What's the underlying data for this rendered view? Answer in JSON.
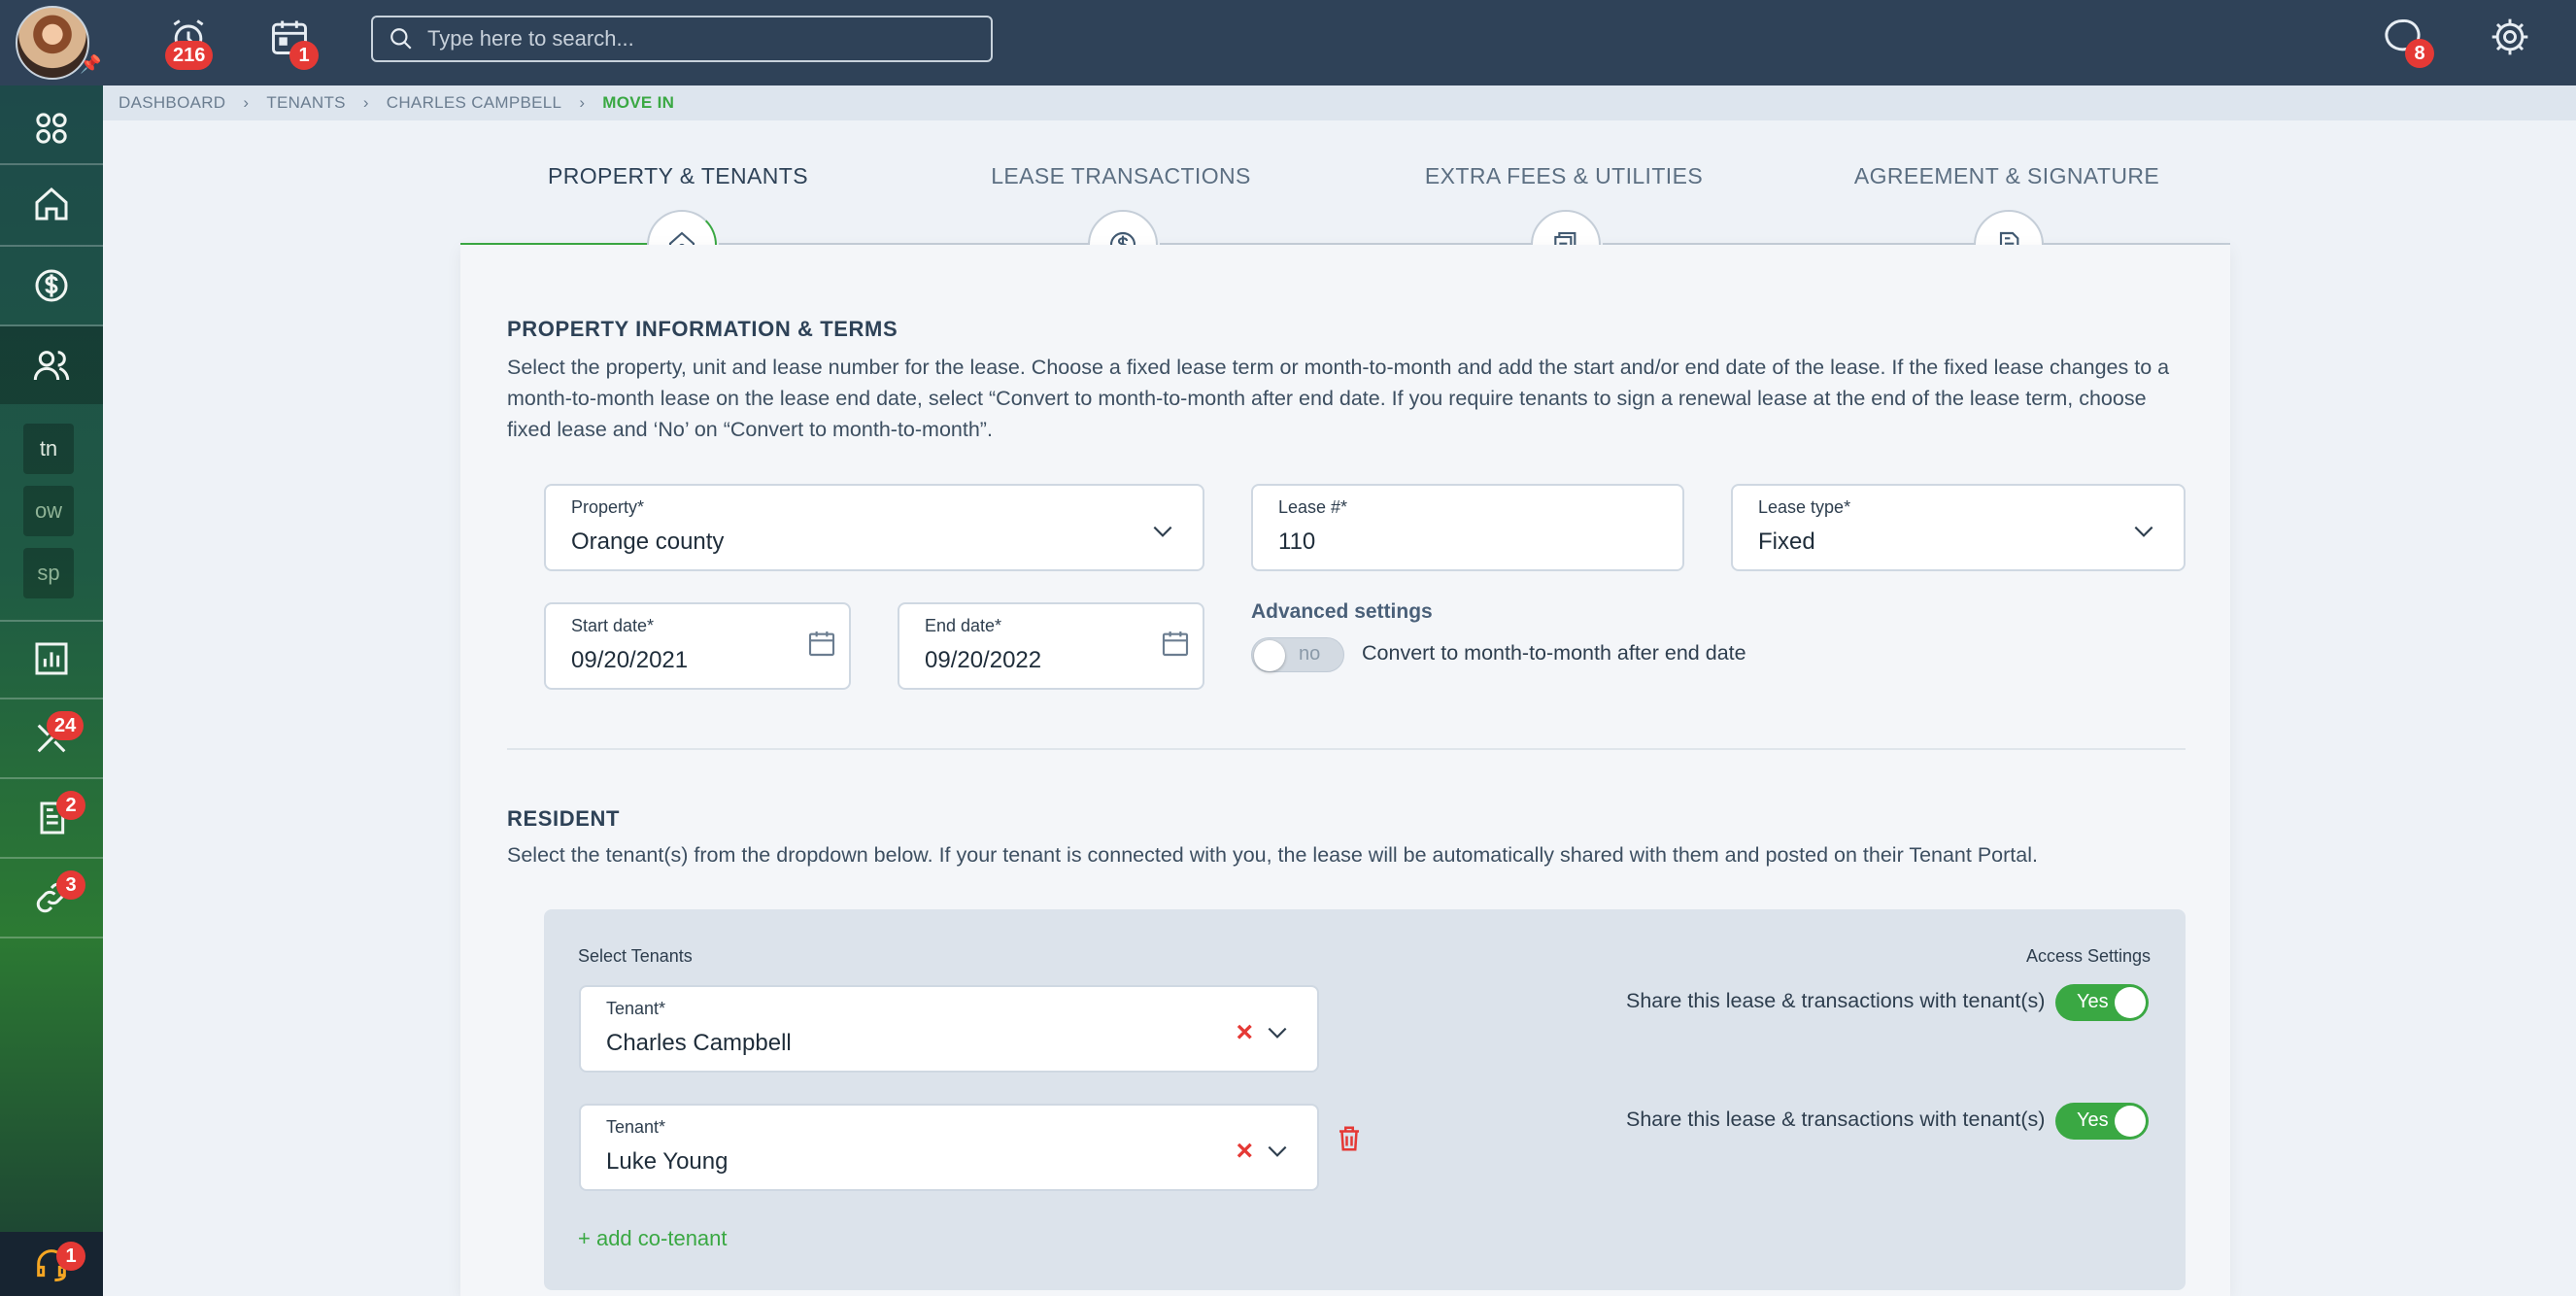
{
  "topbar": {
    "search_placeholder": "Type here to search...",
    "alarm_badge": "216",
    "calendar_badge": "1",
    "chat_badge": "8"
  },
  "sidebar": {
    "chips": [
      "tn",
      "ow",
      "sp"
    ],
    "maintenance_badge": "24",
    "documents_badge": "2",
    "links_badge": "3",
    "support_badge": "1"
  },
  "breadcrumb": [
    "DASHBOARD",
    "TENANTS",
    "CHARLES CAMPBELL",
    "MOVE IN"
  ],
  "steps": [
    {
      "label": "PROPERTY & TENANTS",
      "icon": "home-icon"
    },
    {
      "label": "LEASE TRANSACTIONS",
      "icon": "dollar-icon"
    },
    {
      "label": "EXTRA FEES & UTILITIES",
      "icon": "documents-icon"
    },
    {
      "label": "AGREEMENT & SIGNATURE",
      "icon": "document-icon"
    }
  ],
  "property_section": {
    "title": "PROPERTY INFORMATION & TERMS",
    "description": "Select the property, unit and lease number for the lease. Choose a fixed lease term or month-to-month and add the start and/or end date of the lease. If the fixed lease changes to a month-to-month lease on the lease end date, select “Convert to month-to-month after end date. If you require tenants to sign a renewal lease at the end of the lease term, choose fixed lease and ‘No’ on “Convert to month-to-month”.",
    "property": {
      "label": "Property*",
      "value": "Orange county"
    },
    "lease_number": {
      "label": "Lease #*",
      "value": "110"
    },
    "lease_type": {
      "label": "Lease type*",
      "value": "Fixed"
    },
    "start_date": {
      "label": "Start date*",
      "value": "09/20/2021"
    },
    "end_date": {
      "label": "End date*",
      "value": "09/20/2022"
    },
    "advanced_title": "Advanced settings",
    "convert_toggle": "no",
    "convert_label": "Convert to month-to-month after end date"
  },
  "resident_section": {
    "title": "RESIDENT",
    "description": "Select the tenant(s) from the dropdown below. If your tenant is connected with you, the lease will be automatically shared with them and posted on their Tenant Portal.",
    "select_label": "Select Tenants",
    "access_label": "Access Settings",
    "tenants": [
      {
        "label": "Tenant*",
        "value": "Charles Campbell",
        "share_text": "Share this lease & transactions with tenant(s)",
        "share_toggle": "Yes"
      },
      {
        "label": "Tenant*",
        "value": "Luke Young",
        "share_text": "Share this lease & transactions with tenant(s)",
        "share_toggle": "Yes"
      }
    ],
    "add_label": "+ add co-tenant"
  },
  "colors": {
    "accent": "#3aa843",
    "header": "#2f4258",
    "badge": "#e53935"
  }
}
